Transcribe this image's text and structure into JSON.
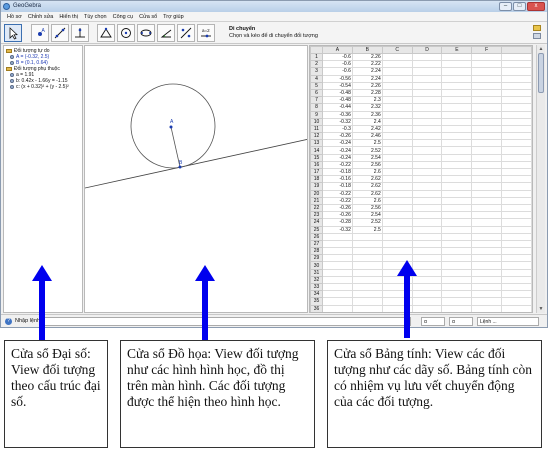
{
  "window": {
    "title": "GeoGebra",
    "controls": {
      "minimize": "–",
      "maximize": "□",
      "close": "x"
    }
  },
  "menu": [
    "Hồ sơ",
    "Chỉnh sửa",
    "Hiển thị",
    "Tùy chọn",
    "Công cụ",
    "Cửa sổ",
    "Trợ giúp"
  ],
  "toolbar": {
    "tool_icons": [
      "move-tool-icon",
      "point-tool-icon",
      "line-tool-icon",
      "perpendicular-tool-icon",
      "polygon-tool-icon",
      "circle-tool-icon",
      "conic-tool-icon",
      "angle-tool-icon",
      "reflect-tool-icon",
      "slider-tool-icon",
      "move-view-tool-icon"
    ],
    "slider_tool_text": "a=2",
    "desc_title": "Di chuyển",
    "desc_text": "Chọn và kéo để di chuyển đối tượng"
  },
  "algebra": {
    "free_header": "Đối tượng tự do",
    "free_items": [
      "A = (-0.32, 2.5)",
      "B = (0.1, 0.64)"
    ],
    "dependent_header": "Đối tượng phụ thuộc",
    "dependent_items": [
      "a = 1.91",
      "b: 0.42x - 1.66y = -1.15",
      "c: (x + 0.32)² + (y - 2.5)²"
    ]
  },
  "graphics": {
    "point_a_label": "A",
    "point_b_label": "B"
  },
  "spreadsheet": {
    "columns": [
      "A",
      "B",
      "C",
      "D",
      "E",
      "F"
    ],
    "rows": [
      [
        "1",
        "-0.6",
        "2.26"
      ],
      [
        "2",
        "-0.6",
        "2.22"
      ],
      [
        "3",
        "-0.6",
        "2.24"
      ],
      [
        "4",
        "-0.56",
        "2.24"
      ],
      [
        "5",
        "-0.54",
        "2.26"
      ],
      [
        "6",
        "-0.48",
        "2.28"
      ],
      [
        "7",
        "-0.48",
        "2.3"
      ],
      [
        "8",
        "-0.44",
        "2.32"
      ],
      [
        "9",
        "-0.36",
        "2.36"
      ],
      [
        "10",
        "-0.32",
        "2.4"
      ],
      [
        "11",
        "-0.3",
        "2.42"
      ],
      [
        "12",
        "-0.26",
        "2.46"
      ],
      [
        "13",
        "-0.24",
        "2.5"
      ],
      [
        "14",
        "-0.24",
        "2.52"
      ],
      [
        "15",
        "-0.24",
        "2.54"
      ],
      [
        "16",
        "-0.22",
        "2.56"
      ],
      [
        "17",
        "-0.18",
        "2.6"
      ],
      [
        "18",
        "-0.16",
        "2.62"
      ],
      [
        "19",
        "-0.18",
        "2.62"
      ],
      [
        "20",
        "-0.22",
        "2.62"
      ],
      [
        "21",
        "-0.22",
        "2.6"
      ],
      [
        "22",
        "-0.26",
        "2.56"
      ],
      [
        "23",
        "-0.26",
        "2.54"
      ],
      [
        "24",
        "-0.28",
        "2.52"
      ],
      [
        "25",
        "-0.32",
        "2.5"
      ],
      [
        "26",
        "",
        ""
      ],
      [
        "27",
        "",
        ""
      ],
      [
        "28",
        "",
        ""
      ],
      [
        "29",
        "",
        ""
      ],
      [
        "30",
        "",
        ""
      ],
      [
        "31",
        "",
        ""
      ],
      [
        "32",
        "",
        ""
      ],
      [
        "33",
        "",
        ""
      ],
      [
        "34",
        "",
        ""
      ],
      [
        "35",
        "",
        ""
      ],
      [
        "36",
        "",
        ""
      ]
    ]
  },
  "inputbar": {
    "help_icon_text": "?",
    "label": "Nhập lệnh:",
    "select_1": "α",
    "select_2": "α",
    "select_3": "Lệnh ..."
  },
  "captions": {
    "algebra": "Cửa sổ Đại số: View đối tượng theo cấu trúc đại số.",
    "graphics": "Cửa sổ Đồ họa: View đối tượng như các hình hình học, đồ thị trên màn hình. Các đối tượng được thể hiện theo hình học.",
    "spreadsheet": "Cửa sổ Bảng tính: View các đối tượng như các dãy số. Bảng tính còn có nhiệm vụ lưu vết chuyển động của các đối tượng."
  },
  "colors": {
    "arrow": "#0000ee",
    "point_label": "#1a3cb0",
    "title_bar": "#c6d9ef"
  }
}
